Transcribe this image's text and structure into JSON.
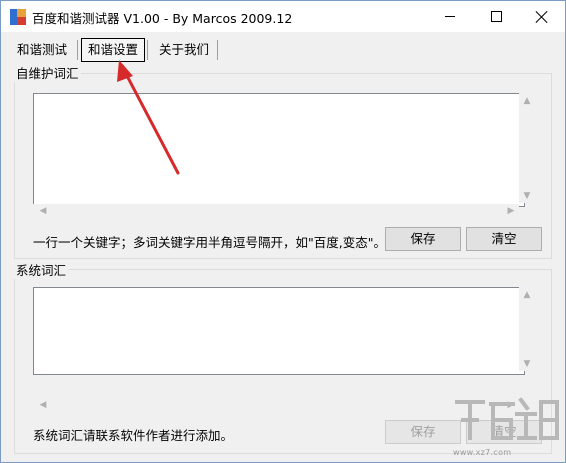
{
  "window": {
    "title": "百度和谐测试器 V1.00 - By Marcos 2009.12",
    "icon": "app-icon"
  },
  "tabs": [
    {
      "label": "和谐测试",
      "selected": false
    },
    {
      "label": "和谐设置",
      "selected": true
    },
    {
      "label": "关于我们",
      "selected": false
    }
  ],
  "group_custom": {
    "title": "自维护词汇",
    "text_value": "",
    "hint": "一行一个关键字；多词关键字用半角逗号隔开，如\"百度,变态\"。",
    "save_label": "保存",
    "clear_label": "清空"
  },
  "group_system": {
    "title": "系统词汇",
    "text_value": "",
    "hint": "系统词汇请联系软件作者进行添加。",
    "save_label": "保存",
    "clear_label": "清空",
    "buttons_enabled": false
  },
  "annotation": {
    "color": "#d62a2a"
  },
  "watermark": {
    "text": "www.xz7.com"
  }
}
